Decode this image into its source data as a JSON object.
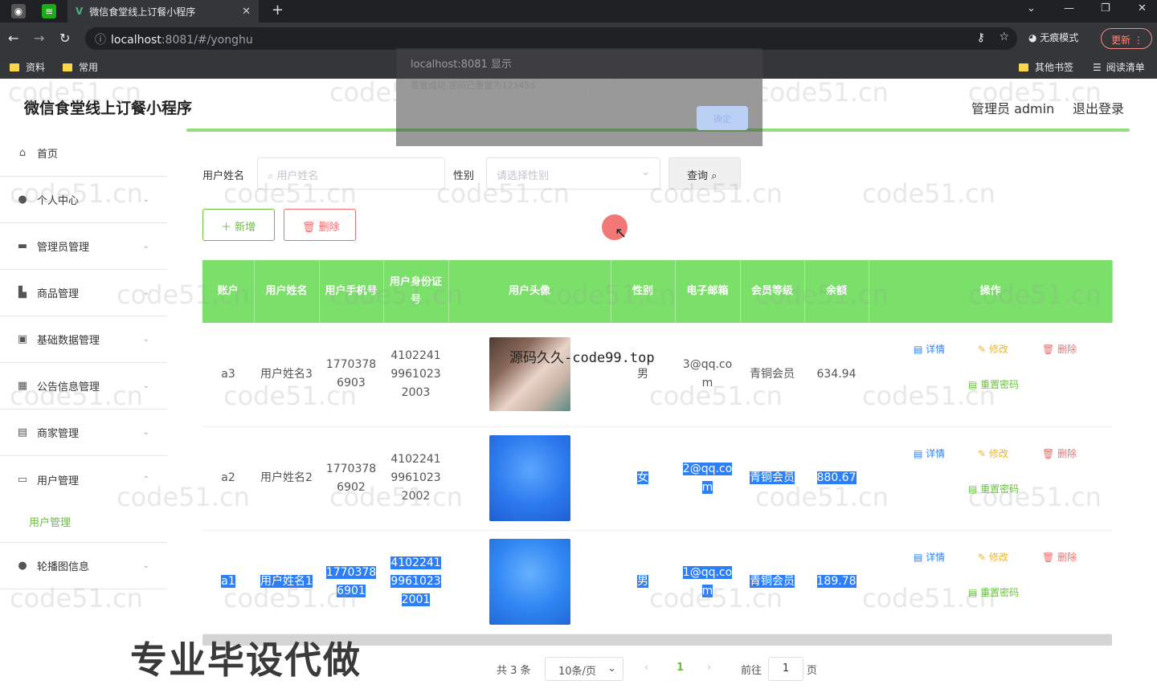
{
  "browser": {
    "tab_title": "微信食堂线上订餐小程序",
    "tab_logo": "V",
    "tab_close": "✕",
    "new_tab": "+",
    "url_host": "localhost",
    "url_path": ":8081/#/yonghu",
    "incognito_label": "无痕模式",
    "update_label": "更新",
    "bookmarks": [
      "资料",
      "常用"
    ],
    "bookmarks_right": [
      "其他书签",
      "阅读清单"
    ]
  },
  "dialog": {
    "title": "localhost:8081 显示",
    "message": "重置成功,密码已重置为123456",
    "ok_label": "确定"
  },
  "header": {
    "app_title": "微信食堂线上订餐小程序",
    "admin_label": "管理员 admin",
    "logout_label": "退出登录"
  },
  "sidebar": {
    "items": [
      {
        "label": "首页",
        "icon": "home-icon"
      },
      {
        "label": "个人中心",
        "icon": "user-icon"
      },
      {
        "label": "管理员管理",
        "icon": "admin-icon"
      },
      {
        "label": "商品管理",
        "icon": "goods-icon"
      },
      {
        "label": "基础数据管理",
        "icon": "data-icon"
      },
      {
        "label": "公告信息管理",
        "icon": "notice-icon"
      },
      {
        "label": "商家管理",
        "icon": "shop-icon"
      },
      {
        "label": "用户管理",
        "icon": "users-icon"
      }
    ],
    "sub_item": "用户管理",
    "last_item": {
      "label": "轮播图信息",
      "icon": "carousel-icon"
    }
  },
  "search": {
    "name_label": "用户姓名",
    "name_placeholder": "用户姓名",
    "gender_label": "性别",
    "gender_placeholder": "请选择性别",
    "query_label": "查询"
  },
  "actions": {
    "add_label": "新增",
    "delete_label": "删除"
  },
  "table": {
    "headers": [
      "账户",
      "用户姓名",
      "用户手机号",
      "用户身份证号",
      "用户头像",
      "性别",
      "电子邮箱",
      "会员等级",
      "余额",
      "操作"
    ],
    "rows": [
      {
        "account": "a3",
        "name": "用户姓名3",
        "phone": "17703786903",
        "id_card": "410224199610232003",
        "gender": "男",
        "email": "3@qq.com",
        "level": "青铜会员",
        "balance": "634.94"
      },
      {
        "account": "a2",
        "name": "用户姓名2",
        "phone": "17703786902",
        "id_card": "410224199610232002",
        "gender": "女",
        "email": "2@qq.com",
        "level": "青铜会员",
        "balance": "880.67"
      },
      {
        "account": "a1",
        "name": "用户姓名1",
        "phone": "17703786901",
        "id_card": "410224199610232001",
        "gender": "男",
        "email": "1@qq.com",
        "level": "青铜会员",
        "balance": "189.78"
      }
    ],
    "op_detail": "详情",
    "op_edit": "修改",
    "op_delete": "删除",
    "op_reset": "重置密码"
  },
  "overlay_text": "源码久久-code99.top",
  "pagination": {
    "total": "共 3 条",
    "page_size": "10条/页",
    "current_page": "1",
    "goto_label": "前往",
    "goto_value": "1",
    "page_unit": "页"
  },
  "caption": "专业毕设代做",
  "watermark": "code51.cn"
}
